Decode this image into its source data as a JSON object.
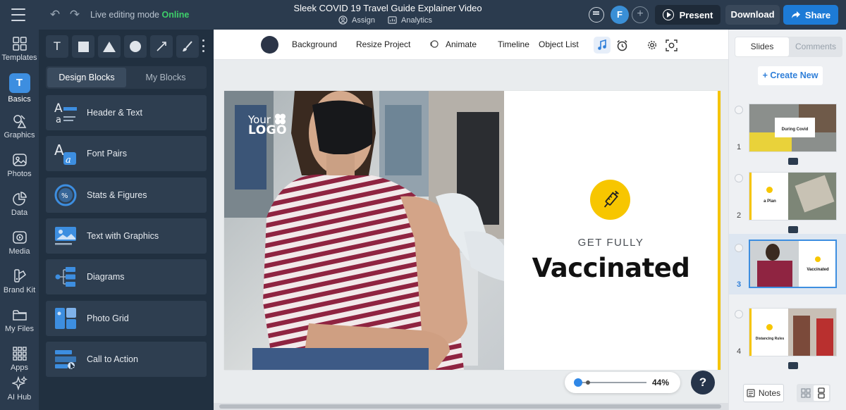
{
  "topbar": {
    "mode_label": "Live editing mode",
    "mode_status": "Online",
    "project_title": "Sleek COVID 19 Travel Guide Explainer Video",
    "assign_label": "Assign",
    "analytics_label": "Analytics",
    "avatar_initial": "F",
    "present_label": "Present",
    "download_label": "Download",
    "share_label": "Share"
  },
  "rail": {
    "items": [
      {
        "label": "Templates",
        "icon": "templates-icon"
      },
      {
        "label": "Basics",
        "icon": "text-t-icon",
        "active": true
      },
      {
        "label": "Graphics",
        "icon": "graphics-icon"
      },
      {
        "label": "Photos",
        "icon": "photos-icon"
      },
      {
        "label": "Data",
        "icon": "pie-chart-icon"
      },
      {
        "label": "Media",
        "icon": "media-icon"
      },
      {
        "label": "Brand Kit",
        "icon": "brand-kit-icon"
      },
      {
        "label": "My Files",
        "icon": "folder-icon"
      },
      {
        "label": "Apps",
        "icon": "apps-grid-icon"
      },
      {
        "label": "AI Hub",
        "icon": "ai-sparkle-icon"
      }
    ]
  },
  "panel": {
    "tabs": {
      "design": "Design Blocks",
      "mine": "My Blocks"
    },
    "blocks": [
      "Header & Text",
      "Font Pairs",
      "Stats & Figures",
      "Text with Graphics",
      "Diagrams",
      "Photo Grid",
      "Call to Action"
    ]
  },
  "canvas_toolbar": {
    "background": "Background",
    "resize": "Resize Project",
    "animate": "Animate",
    "timeline": "Timeline",
    "object_list": "Object List"
  },
  "slide": {
    "logo_line1": "Your",
    "logo_line2": "LOGO",
    "heading_small": "GET FULLY",
    "heading_large": "Vaccinated",
    "accent_color": "#f7c600"
  },
  "zoom": {
    "value": "44%"
  },
  "help": {
    "label": "?"
  },
  "right_panel": {
    "tabs": {
      "slides": "Slides",
      "comments": "Comments"
    },
    "create_new": "+ Create New",
    "thumbnails": [
      {
        "number": "1",
        "text": "During Covid"
      },
      {
        "number": "2",
        "text": "a Plan"
      },
      {
        "number": "3",
        "text": "Vaccinated",
        "selected": true
      },
      {
        "number": "4",
        "text": "Distancing Rules"
      }
    ],
    "notes_label": "Notes"
  }
}
